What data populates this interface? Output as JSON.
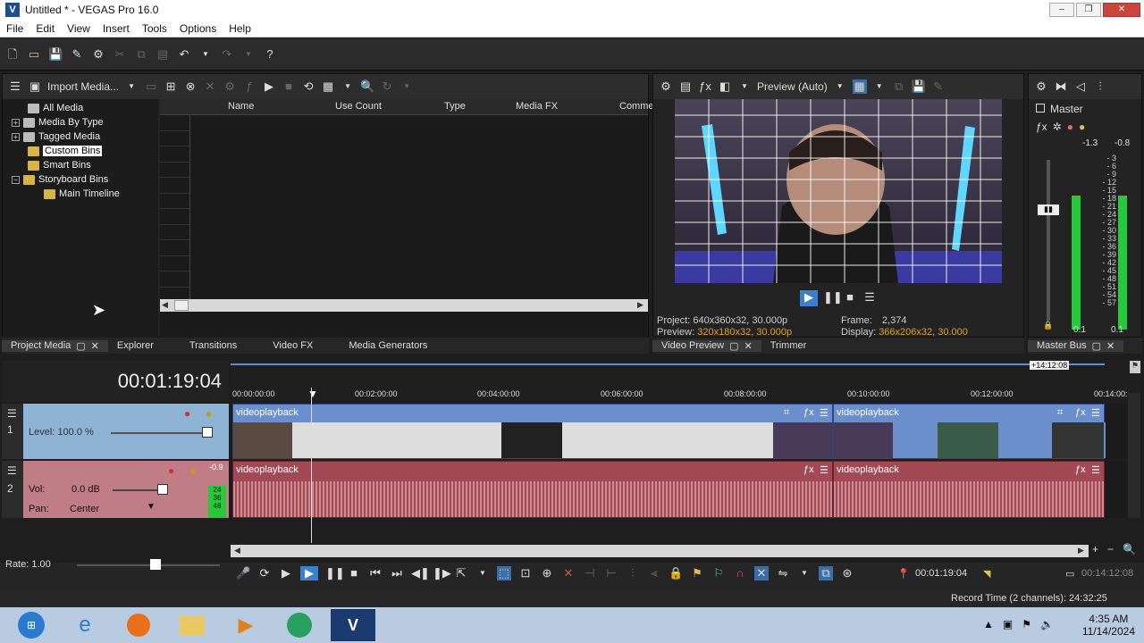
{
  "window": {
    "title": "Untitled * - VEGAS Pro 16.0",
    "app_icon": "V"
  },
  "menu": [
    "File",
    "Edit",
    "View",
    "Insert",
    "Tools",
    "Options",
    "Help"
  ],
  "project_media": {
    "import_label": "Import Media...",
    "tree": [
      "All Media",
      "Media By Type",
      "Tagged Media",
      "Custom Bins",
      "Smart Bins",
      "Storyboard Bins",
      "Main Timeline"
    ],
    "columns": [
      "Name",
      "Use Count",
      "Type",
      "Media FX",
      "Comme"
    ]
  },
  "dock_tabs": {
    "left": [
      "Project Media",
      "Explorer",
      "Transitions",
      "Video FX",
      "Media Generators"
    ],
    "preview": [
      "Video Preview",
      "Trimmer"
    ],
    "master": [
      "Master Bus"
    ]
  },
  "preview": {
    "quality": "Preview (Auto)",
    "project_label": "Project:",
    "project_value": "640x360x32, 30.000p",
    "preview_label": "Preview:",
    "preview_value": "320x180x32, 30.000p",
    "frame_label": "Frame:",
    "frame_value": "2,374",
    "display_label": "Display:",
    "display_value": "366x206x32, 30.000"
  },
  "master": {
    "title": "Master",
    "peak_l": "-1.3",
    "peak_r": "-0.8",
    "scale": [
      "3",
      "6",
      "9",
      "12",
      "15",
      "18",
      "21",
      "24",
      "27",
      "30",
      "33",
      "36",
      "39",
      "42",
      "45",
      "48",
      "51",
      "54",
      "57"
    ],
    "bottom_l": "0.1",
    "bottom_r": "0.1"
  },
  "timeline": {
    "time": "00:01:19:04",
    "end_marker": "+14:12:08",
    "ruler": [
      "00:00:00:00",
      "00:02:00:00",
      "00:04:00:00",
      "00:06:00:00",
      "00:08:00:00",
      "00:10:00:00",
      "00:12:00:00",
      "00:14:00:"
    ]
  },
  "tracks": {
    "video": {
      "number": "1",
      "level_label": "Level: 100.0 %"
    },
    "audio": {
      "number": "2",
      "vol_label": "Vol:",
      "vol_value": "0.0 dB",
      "pan_label": "Pan:",
      "pan_value": "Center",
      "meter_peak": "-0.9",
      "meter_scale": [
        "24",
        "36",
        "48"
      ]
    }
  },
  "clips": {
    "video": [
      "videoplayback",
      "videoplayback"
    ],
    "audio": [
      "videoplayback",
      "videoplayback"
    ]
  },
  "transport": {
    "rate": "Rate: 1.00",
    "cursor": "00:01:19:04",
    "length": "00:14:12:08"
  },
  "status": {
    "record_time": "Record Time (2 channels): 24:32:25"
  },
  "taskbar": {
    "time": "4:35 AM",
    "date": "11/14/2024"
  }
}
